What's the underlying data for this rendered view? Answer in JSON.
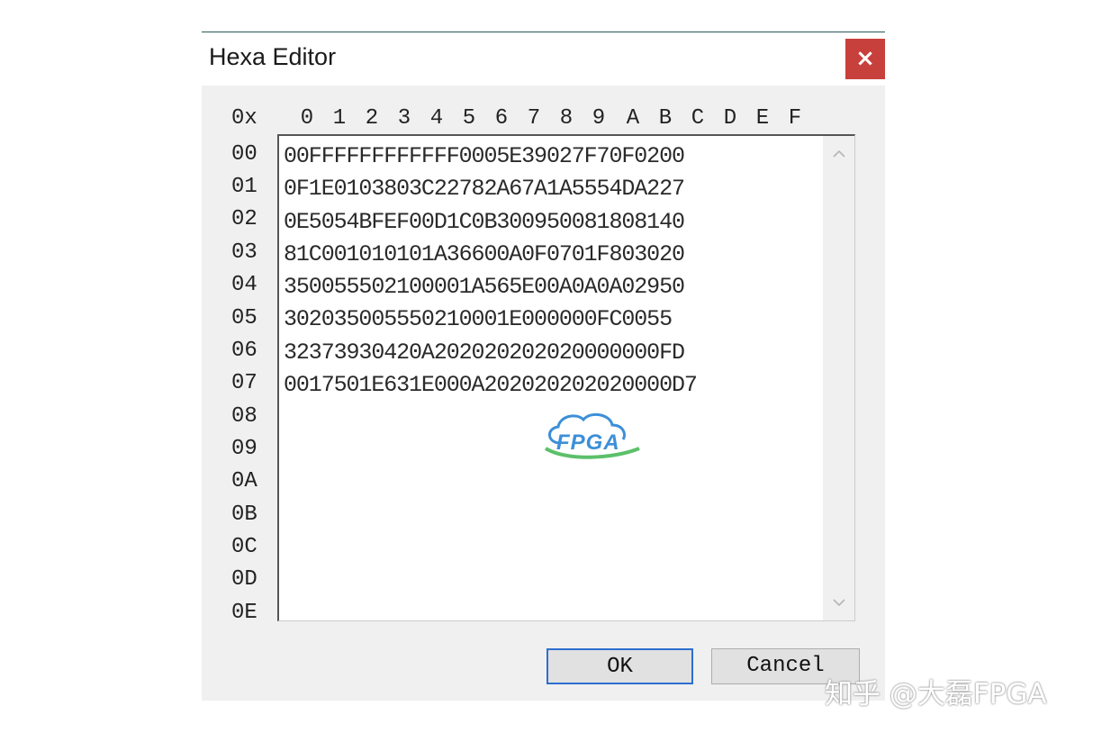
{
  "window": {
    "title": "Hexa Editor",
    "close_label": "×"
  },
  "editor": {
    "prefix_label": "0x",
    "column_headers": [
      "0",
      "1",
      "2",
      "3",
      "4",
      "5",
      "6",
      "7",
      "8",
      "9",
      "A",
      "B",
      "C",
      "D",
      "E",
      "F"
    ],
    "row_labels": [
      "00",
      "01",
      "02",
      "03",
      "04",
      "05",
      "06",
      "07",
      "08",
      "09",
      "0A",
      "0B",
      "0C",
      "0D",
      "0E"
    ],
    "hex_lines": [
      "00FFFFFFFFFFFF0005E39027F70F0200",
      "0F1E0103803C22782A67A1A5554DA227",
      "0E5054BFEF00D1C0B300950081808140",
      "81C001010101A36600A0F0701F803020",
      "350055502100001A565E00A0A0A02950",
      "302035005550210001E000000FC0055",
      "32373930420A202020202020000000FD",
      "0017501E631E000A202020202020000D7"
    ]
  },
  "buttons": {
    "ok_label": "OK",
    "cancel_label": "Cancel"
  },
  "watermark": {
    "logo_text": "FPGA",
    "credit_text": "知乎 @大磊FPGA"
  },
  "colors": {
    "close_bg": "#c8403b",
    "ok_border": "#2d6fcf",
    "dialog_bg": "#f0f0f0"
  }
}
